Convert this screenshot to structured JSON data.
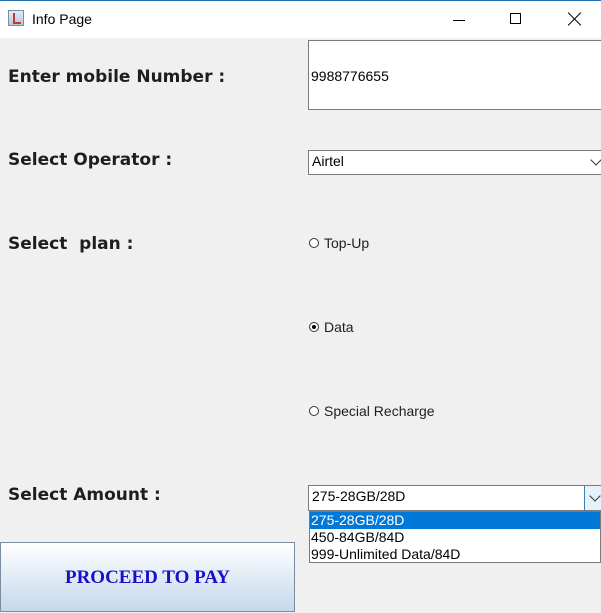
{
  "window": {
    "title": "Info Page"
  },
  "form": {
    "mobile_label": "Enter mobile Number :",
    "mobile_value": "9988776655",
    "operator_label": "Select Operator :",
    "operator_value": "Airtel",
    "plan_label": "Select  plan :",
    "plan_options": [
      {
        "label": "Top-Up",
        "checked": false
      },
      {
        "label": "Data",
        "checked": true
      },
      {
        "label": "Special Recharge",
        "checked": false
      }
    ],
    "amount_label": "Select Amount :",
    "amount_value": "275-28GB/28D",
    "amount_options": [
      "275-28GB/28D",
      "450-84GB/84D",
      "999-Unlimited Data/84D"
    ],
    "amount_selected_index": 0,
    "proceed_label": "PROCEED TO PAY"
  },
  "colors": {
    "button_text": "#1a10c8",
    "selection": "#0078d7"
  }
}
